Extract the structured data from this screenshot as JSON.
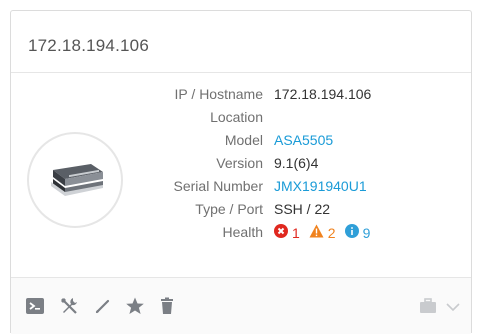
{
  "device": {
    "title": "172.18.194.106",
    "image_icon": "network-switch-icon"
  },
  "details": [
    {
      "label": "IP / Hostname",
      "value": "172.18.194.106",
      "link": false
    },
    {
      "label": "Location",
      "value": "",
      "link": false
    },
    {
      "label": "Model",
      "value": "ASA5505",
      "link": true
    },
    {
      "label": "Version",
      "value": "9.1(6)4",
      "link": false
    },
    {
      "label": "Serial Number",
      "value": "JMX191940U1",
      "link": true
    },
    {
      "label": "Type / Port",
      "value": "SSH / 22",
      "link": false
    }
  ],
  "health": {
    "label": "Health",
    "critical": "1",
    "warning": "2",
    "info": "9",
    "colors": {
      "critical": "#e0281f",
      "warning": "#f0821e",
      "info": "#2f9fd8"
    }
  },
  "toolbar": {
    "icons": [
      "terminal-icon",
      "tools-icon",
      "edit-icon",
      "star-icon",
      "trash-icon",
      "briefcase-icon",
      "chevron-down-icon"
    ]
  },
  "colors": {
    "link": "#1a9bd7",
    "label": "#707070",
    "text": "#333333"
  }
}
